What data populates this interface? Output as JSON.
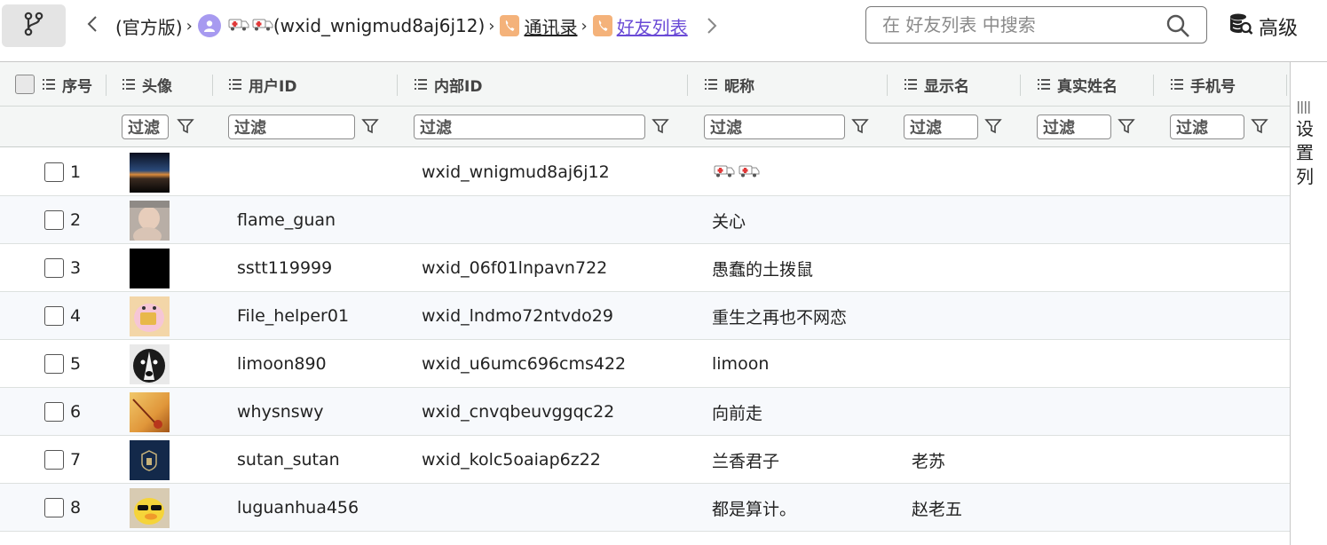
{
  "breadcrumb": {
    "root": "(官方版)",
    "account": "(wxid_wnigmud8aj6j12)",
    "contacts": "通讯录",
    "friends": "好友列表"
  },
  "search": {
    "placeholder": "在 好友列表 中搜索"
  },
  "advanced_label": "高级",
  "columns": {
    "seq": "序号",
    "avatar": "头像",
    "user_id": "用户ID",
    "internal_id": "内部ID",
    "nickname": "昵称",
    "display_name": "显示名",
    "real_name": "真实姓名",
    "phone": "手机号"
  },
  "filter_placeholder": "过滤",
  "side_panel": {
    "label": "设置列"
  },
  "rows": [
    {
      "seq": "1",
      "user_id": "",
      "internal_id": "wxid_wnigmud8aj6j12",
      "nickname": "",
      "display_name": "",
      "avatar": "earth-horizon"
    },
    {
      "seq": "2",
      "user_id": "flame_guan",
      "internal_id": "",
      "nickname": "关心",
      "display_name": "",
      "avatar": "baby"
    },
    {
      "seq": "3",
      "user_id": "sstt119999",
      "internal_id": "wxid_06f01lnpavn722",
      "nickname": "愚蠢的土拨鼠",
      "display_name": "",
      "avatar": "black"
    },
    {
      "seq": "4",
      "user_id": "File_helper01",
      "internal_id": "wxid_lndmo72ntvdo29",
      "nickname": "重生之再也不网恋",
      "display_name": "",
      "avatar": "cartoon-pig"
    },
    {
      "seq": "5",
      "user_id": "limoon890",
      "internal_id": "wxid_u6umc696cms422",
      "nickname": "limoon",
      "display_name": "",
      "avatar": "dog"
    },
    {
      "seq": "6",
      "user_id": "whysnswy",
      "internal_id": "wxid_cnvqbeuvggqc22",
      "nickname": "向前走",
      "display_name": "",
      "avatar": "sunset-field"
    },
    {
      "seq": "7",
      "user_id": "sutan_sutan",
      "internal_id": "wxid_kolc5oaiap6z22",
      "nickname": "兰香君子",
      "display_name": "老苏",
      "avatar": "navy-emblem"
    },
    {
      "seq": "8",
      "user_id": "luguanhua456",
      "internal_id": "",
      "nickname": "都是算计。",
      "display_name": "赵老五",
      "avatar": "duck-sunglasses"
    }
  ],
  "colors": {
    "accent": "#6a4ad6",
    "header_bg": "#f4f6f5",
    "alt_row": "#f7f9fc",
    "tag_orange": "#f4b27a",
    "avatar_purple": "#a79af0"
  }
}
